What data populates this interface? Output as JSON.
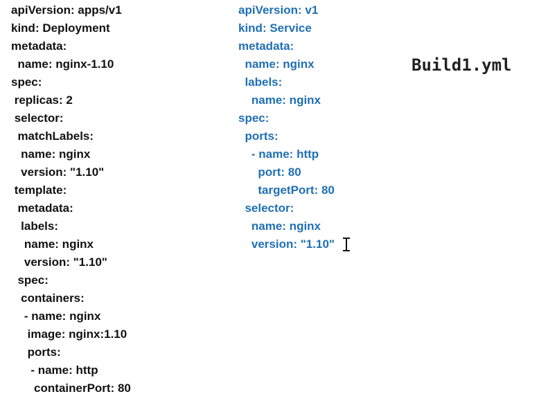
{
  "title": "Build1.yml",
  "deployment": {
    "lines": [
      "apiVersion: apps/v1",
      "kind: Deployment",
      "metadata:",
      "  name: nginx-1.10",
      "spec:",
      " replicas: 2",
      " selector:",
      "  matchLabels:",
      "   name: nginx",
      "   version: \"1.10\"",
      " template:",
      "  metadata:",
      "   labels:",
      "    name: nginx",
      "    version: \"1.10\"",
      "  spec:",
      "   containers:",
      "    - name: nginx",
      "     image: nginx:1.10",
      "     ports:",
      "      - name: http",
      "       containerPort: 80"
    ]
  },
  "service": {
    "lines": [
      "apiVersion: v1",
      "kind: Service",
      "metadata:",
      "  name: nginx",
      "  labels:",
      "    name: nginx",
      "spec:",
      "  ports:",
      "    - name: http",
      "      port: 80",
      "      targetPort: 80",
      "  selector:",
      "    name: nginx",
      "    version: \"1.10\""
    ]
  },
  "colors": {
    "left_text": "#111111",
    "right_text": "#1f6fb5"
  }
}
